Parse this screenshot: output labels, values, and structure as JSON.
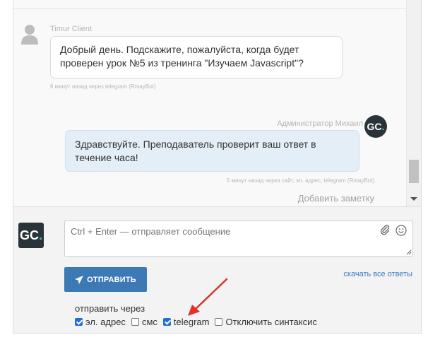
{
  "chat": {
    "client": {
      "name": "Timur Client",
      "message": "Добрый день. Подскажите, пожалуйста, когда будет проверен урок №5 из тренинга \"Изучаем Javascript\"?",
      "meta": "6 минут назад через telegram (RmayBot)"
    },
    "admin": {
      "name": "Администратор Михаил",
      "avatar_text": "GC",
      "avatar_dot": ".",
      "message": "Здравствуйте. Преподаватель проверит ваш ответ в течение часа!",
      "meta": "5 минут назад через сайт, эл. адрес, telegram (RmayBot)"
    },
    "add_note": "Добавить заметку"
  },
  "composer": {
    "avatar_text": "GC",
    "avatar_dot": ".",
    "input_placeholder": "Ctrl + Enter — отправляет сообщение",
    "send_label": "ОТПРАВИТЬ",
    "download_link": "скачать все ответы",
    "send_via_label": "отправить через",
    "options": [
      {
        "label": "эл. адрес",
        "checked": true
      },
      {
        "label": "смс",
        "checked": false
      },
      {
        "label": "telegram",
        "checked": true
      },
      {
        "label": "Отключить синтаксис",
        "checked": false
      }
    ]
  },
  "colors": {
    "send_button": "#3c79b5",
    "admin_bubble": "#e3eef6",
    "link": "#3a7cc0",
    "annotation_arrow": "#e0302a",
    "brand_dot": "#49c4b4"
  },
  "icons": [
    "user-silhouette-icon",
    "paperclip-icon",
    "smile-icon",
    "paper-plane-icon",
    "resize-grip-icon",
    "scroll-down-arrow-icon"
  ]
}
